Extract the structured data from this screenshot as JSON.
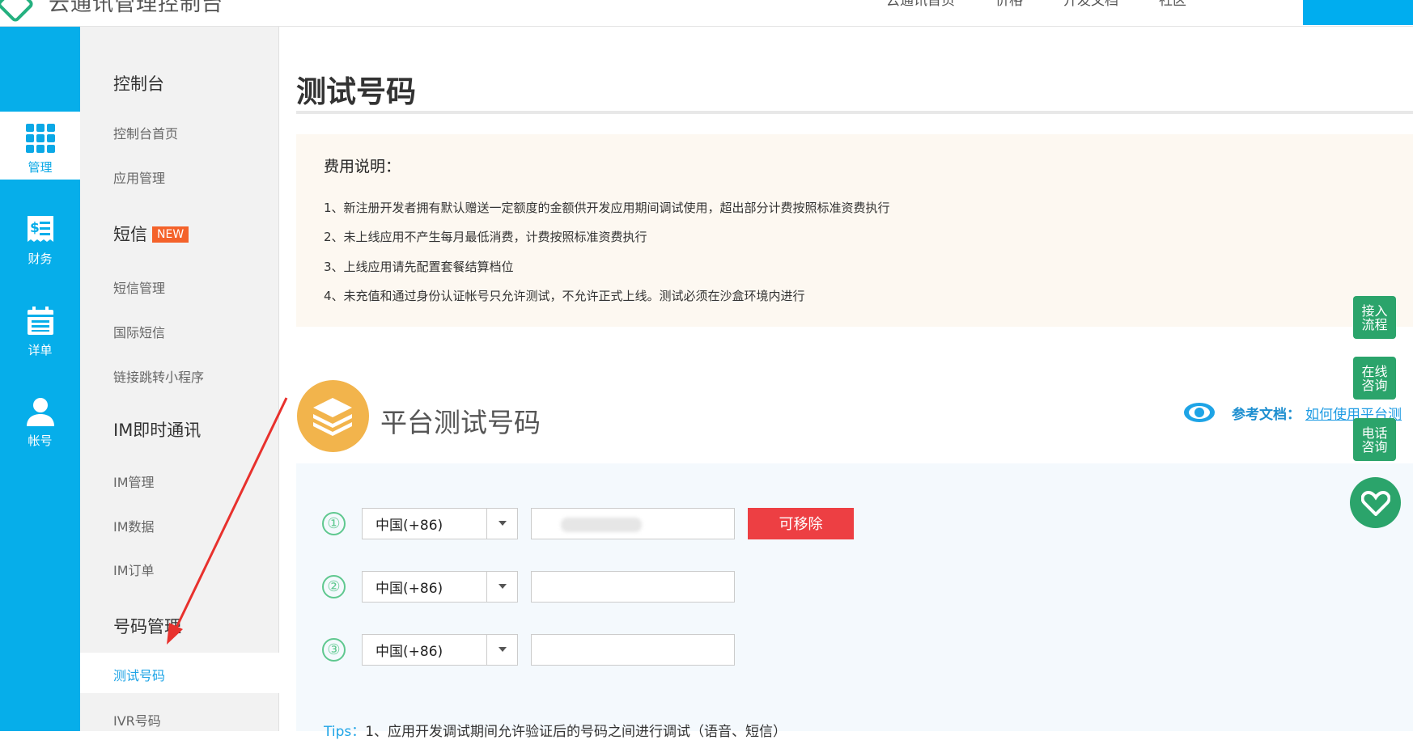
{
  "header": {
    "logo_text": "云通讯管理控制台",
    "nav": [
      "云通讯首页",
      "价格",
      "开发文档",
      "社区"
    ]
  },
  "rail": [
    {
      "label": "管理",
      "icon": "grid-icon",
      "active": true
    },
    {
      "label": "财务",
      "icon": "invoice-icon"
    },
    {
      "label": "详单",
      "icon": "calendar-list-icon"
    },
    {
      "label": "帐号",
      "icon": "user-icon"
    }
  ],
  "menu": {
    "g1": "控制台",
    "i1": "控制台首页",
    "i2": "应用管理",
    "g2": "短信",
    "badge_new": "NEW",
    "i3": "短信管理",
    "i4": "国际短信",
    "i5": "链接跳转小程序",
    "g3": "IM即时通讯",
    "i6": "IM管理",
    "i7": "IM数据",
    "i8": "IM订单",
    "g4": "号码管理",
    "i9": "测试号码",
    "i10": "IVR号码"
  },
  "main": {
    "title": "测试号码",
    "fee": {
      "title": "费用说明：",
      "lines": [
        "1、新注册开发者拥有默认赠送一定额度的金额供开发应用期间调试使用，超出部分计费按照标准资费执行",
        "2、未上线应用不产生每月最低消费，计费按照标准资费执行",
        "3、上线应用请先配置套餐结算档位",
        "4、未充值和通过身份认证帐号只允许测试，不允许正式上线。测试必须在沙盒环境内进行"
      ]
    },
    "platform_title": "平台测试号码",
    "ref_label": "参考文档：",
    "ref_link": "如何使用平台测",
    "rows": [
      {
        "num": "①",
        "country": "中国(+86)",
        "phone": "",
        "remove": "可移除"
      },
      {
        "num": "②",
        "country": "中国(+86)",
        "phone": ""
      },
      {
        "num": "③",
        "country": "中国(+86)",
        "phone": ""
      }
    ],
    "tips_label": "Tips：",
    "tips_text": "1、应用开发调试期间允许验证后的号码之间进行调试（语音、短信）"
  },
  "float": {
    "b1": "接入流程",
    "b2": "在线咨询",
    "b3": "电话咨询"
  },
  "colors": {
    "rail": "#06aeea",
    "accent": "#2ba46b",
    "danger": "#ed3f43"
  }
}
